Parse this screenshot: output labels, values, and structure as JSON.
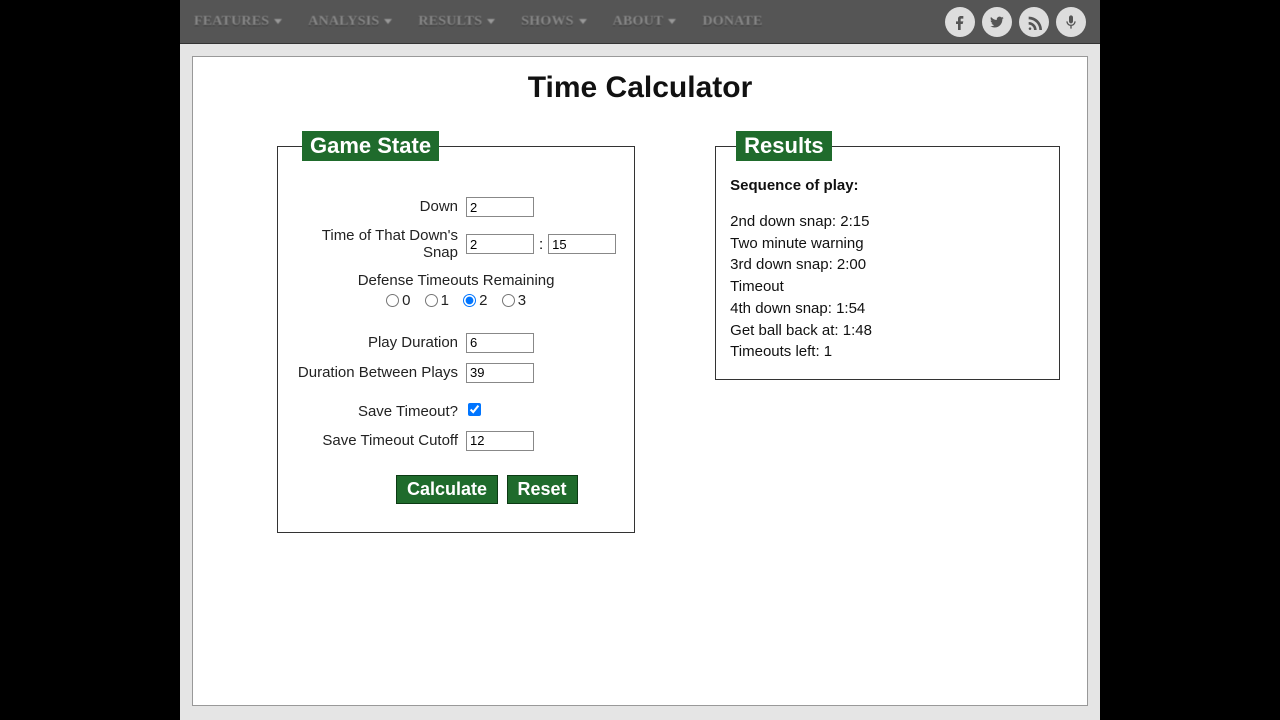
{
  "nav": {
    "items": [
      "FEATURES",
      "ANALYSIS",
      "RESULTS",
      "SHOWS",
      "ABOUT",
      "DONATE"
    ]
  },
  "title": "Time Calculator",
  "gamestate": {
    "legend": "Game State",
    "down_label": "Down",
    "down_value": "2",
    "time_label": "Time of That Down's Snap",
    "time_min": "2",
    "time_sec": "15",
    "timeouts_label": "Defense Timeouts Remaining",
    "timeouts_options": [
      "0",
      "1",
      "2",
      "3"
    ],
    "timeouts_selected": "2",
    "play_duration_label": "Play Duration",
    "play_duration_value": "6",
    "between_label": "Duration Between Plays",
    "between_value": "39",
    "save_to_label": "Save Timeout?",
    "save_to_checked": true,
    "save_cutoff_label": "Save Timeout Cutoff",
    "save_cutoff_value": "12",
    "calc_btn": "Calculate",
    "reset_btn": "Reset"
  },
  "results": {
    "legend": "Results",
    "seq_title": "Sequence of play:",
    "lines": [
      "2nd down snap: 2:15",
      "Two minute warning",
      "3rd down snap: 2:00",
      "Timeout",
      "4th down snap: 1:54",
      "Get ball back at: 1:48",
      "Timeouts left: 1"
    ]
  }
}
